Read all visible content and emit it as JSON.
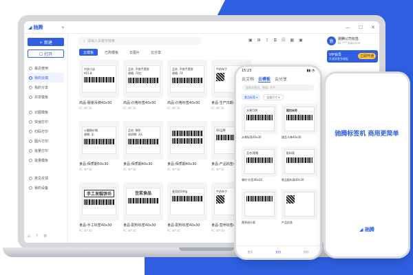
{
  "app": {
    "title": "驰腾",
    "new_tab": "+",
    "window_controls": [
      "—",
      "☐",
      "✕"
    ]
  },
  "sidebar": {
    "new_label": "+ 新建",
    "open_label": "☐ 打开",
    "items": [
      {
        "label": "最近使用"
      },
      {
        "label": "我的云端"
      },
      {
        "label": "我的分享"
      },
      {
        "label": "共享模板"
      },
      {
        "label": "识图模板"
      },
      {
        "label": "快递打印"
      },
      {
        "label": "扫码打印"
      },
      {
        "label": "图片打印"
      },
      {
        "label": "批量打印"
      },
      {
        "label": "批量模板"
      },
      {
        "label": "意见反馈"
      },
      {
        "label": "我的设备"
      }
    ],
    "active_index": 1
  },
  "header": {
    "search_placeholder": "请输入关键字搜索",
    "tools": [
      "▣",
      "⊞",
      "⇪",
      "⧉",
      "☷",
      "▦",
      "▣",
      "⚙"
    ]
  },
  "user": {
    "initial": "驰",
    "name": "驰腾公司标签",
    "id": "ID:****@qq.com"
  },
  "vip": {
    "label": "VIP会员",
    "sub": "开通享更多模板",
    "button": "立即开通"
  },
  "filters": [
    {
      "label": "云模板"
    },
    {
      "label": "已购模板"
    },
    {
      "label": "云图片"
    },
    {
      "label": "云分享"
    }
  ],
  "cards": [
    {
      "t1": "内衣小店",
      "t2": "¥15.8",
      "name": "商品-服装吊牌40x30",
      "meta": "PC 40*30"
    },
    {
      "t1": "品名: 平底手提袋",
      "t2": "规格: 74红",
      "name": "商品-价格标签40x30",
      "meta": "PC 40*30"
    },
    {
      "t1": "品名: 平底手提袋",
      "t2": "规格: 74",
      "name": "商品-价格标签40x30",
      "meta": "PC 40*30"
    },
    {
      "t1": "牛奶布丁",
      "t2": "",
      "name": "食品-生产日期-牛奶布丁",
      "meta": "PC 40*30"
    },
    {
      "t1": "火腿肠价格",
      "t2": "规格: 无",
      "name": "食品-保质期50x30",
      "meta": "PC 40*30"
    },
    {
      "t1": "品名: 鲜奶",
      "t2": "保质期: 3天",
      "name": "食品-保质期40x30",
      "meta": "PC 40*30"
    },
    {
      "t1": "",
      "t2": "",
      "name": "食品-保质期40x30",
      "meta": "PC 40*30"
    },
    {
      "t1": "XX品牌",
      "t2": "",
      "name": "食品-产品标签40x30",
      "meta": "PC 40*30"
    },
    {
      "t1": "手工发糕饼坊",
      "t2": "",
      "name": "食品-手工标签40x30",
      "meta": "PC 40*30"
    },
    {
      "t1": "豆浆食品",
      "t2": "",
      "name": "食品-配料标签40x30",
      "meta": "PC 40*30"
    },
    {
      "t1": "麦而奶500g",
      "t2": "",
      "name": "食品-配料标签40x30",
      "meta": "PC 40*30"
    },
    {
      "t1": "牛奶布丁",
      "t2": "",
      "name": "食品-营养标签40x30",
      "meta": "PC 40*30"
    }
  ],
  "phone1": {
    "time": "15:23",
    "signal": "▮▮ ◔",
    "tabs": [
      "云文档",
      "云模板",
      "云分享"
    ],
    "active_tab": 1,
    "search_placeholder": "搜索关键词，例如: 牙子",
    "filter_a": "食品标签 ▾",
    "filter_b": "全部尺寸 ▾",
    "cards": [
      {
        "label": "水果月饼",
        "name": "水果标签40x30"
      },
      {
        "label": "提拉米苏",
        "name": "甜品卡券40x30"
      },
      {
        "label": "品名/规格",
        "name": "餐饮-价签40x30"
      },
      {
        "label": "配料表",
        "name": "食品配料表40x30"
      },
      {
        "label": "",
        "name": "营养成分表"
      },
      {
        "label": "",
        "name": "产品信息"
      }
    ],
    "nav": [
      "首页",
      "文档",
      "我的"
    ],
    "active_nav": 1
  },
  "phone2": {
    "slogan": "驰腾标签机 商用更简单",
    "logo": "驰腾"
  }
}
